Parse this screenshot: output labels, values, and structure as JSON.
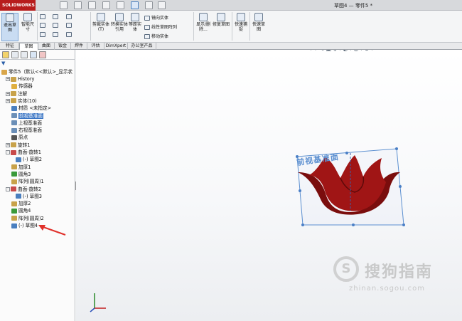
{
  "app": {
    "logo_text": "SOLIDWORKS",
    "document_title": "草图4 — 零件5 *"
  },
  "ribbon": {
    "exit_sketch": "退出草图",
    "smart_dimension": "智能尺寸",
    "trim_entities": "剪裁实体(T)",
    "convert_entities": "转换实体引用",
    "offset_entities": "等距实体",
    "mirror_entities": "镜向实体",
    "linear_pattern": "线性草图阵列",
    "move_entities": "移动实体",
    "display_delete_relations": "显示/删除...",
    "repair_sketch": "修复草图",
    "quick_snaps": "快速捕捉",
    "rapid_sketch": "快速草图"
  },
  "tabs": [
    "特征",
    "草图",
    "曲面",
    "钣金",
    "焊件",
    "评估",
    "DimXpert",
    "办公室产品"
  ],
  "tabs_selected_index": 1,
  "tree": {
    "root": "零件5（默认<<默认>_显示状",
    "items": [
      {
        "label": "History",
        "expand": "+",
        "indent": 1,
        "icon": "history-icon",
        "color": "#c8a24a"
      },
      {
        "label": "传感器",
        "expand": "",
        "indent": 1,
        "icon": "sensor-icon",
        "color": "#e0b040"
      },
      {
        "label": "注解",
        "expand": "+",
        "indent": 1,
        "icon": "annotation-icon",
        "color": "#c8a24a"
      },
      {
        "label": "实体(10)",
        "expand": "+",
        "indent": 1,
        "icon": "solid-bodies-icon",
        "color": "#c8a24a"
      },
      {
        "label": "材质 <未指定>",
        "expand": "",
        "indent": 1,
        "icon": "material-icon",
        "color": "#4a7fbf"
      },
      {
        "label": "前视基准面",
        "expand": "",
        "indent": 1,
        "icon": "plane-icon",
        "color": "#6b8fb8",
        "selected": true
      },
      {
        "label": "上视基准面",
        "expand": "",
        "indent": 1,
        "icon": "plane-icon",
        "color": "#6b8fb8"
      },
      {
        "label": "右视基准面",
        "expand": "",
        "indent": 1,
        "icon": "plane-icon",
        "color": "#6b8fb8"
      },
      {
        "label": "原点",
        "expand": "",
        "indent": 1,
        "icon": "origin-icon",
        "color": "#555555"
      },
      {
        "label": "旋转1",
        "expand": "+",
        "indent": 1,
        "icon": "revolve-icon",
        "color": "#c8a24a"
      },
      {
        "label": "曲面-旋转1",
        "expand": "-",
        "indent": 1,
        "icon": "surface-revolve-icon",
        "color": "#c84a4a"
      },
      {
        "label": "(-) 草图2",
        "expand": "",
        "indent": 2,
        "icon": "sketch-icon",
        "color": "#4a7fbf"
      },
      {
        "label": "加厚1",
        "expand": "",
        "indent": 1,
        "icon": "thicken-icon",
        "color": "#c8a24a"
      },
      {
        "label": "圆角3",
        "expand": "",
        "indent": 1,
        "icon": "fillet-icon",
        "color": "#3a9a3a"
      },
      {
        "label": "阵列(圆周)1",
        "expand": "",
        "indent": 1,
        "icon": "circular-pattern-icon",
        "color": "#c8a24a"
      },
      {
        "label": "曲面-旋转2",
        "expand": "-",
        "indent": 1,
        "icon": "surface-revolve-icon",
        "color": "#c84a4a"
      },
      {
        "label": "(-) 草图3",
        "expand": "",
        "indent": 2,
        "icon": "sketch-icon",
        "color": "#4a7fbf"
      },
      {
        "label": "加厚2",
        "expand": "",
        "indent": 1,
        "icon": "thicken-icon",
        "color": "#c8a24a"
      },
      {
        "label": "圆角4",
        "expand": "",
        "indent": 1,
        "icon": "fillet-icon",
        "color": "#3a9a3a"
      },
      {
        "label": "阵列(圆周)2",
        "expand": "",
        "indent": 1,
        "icon": "circular-pattern-icon",
        "color": "#c8a24a"
      },
      {
        "label": "(-) 草图4",
        "expand": "",
        "indent": 1,
        "icon": "sketch-icon",
        "color": "#4a7fbf"
      }
    ]
  },
  "viewport": {
    "plane_label": "前视基准面",
    "model_color": "#8b0f0f",
    "watermark_brand": "搜狗指南",
    "watermark_url": "zhinan.sogou.com"
  }
}
